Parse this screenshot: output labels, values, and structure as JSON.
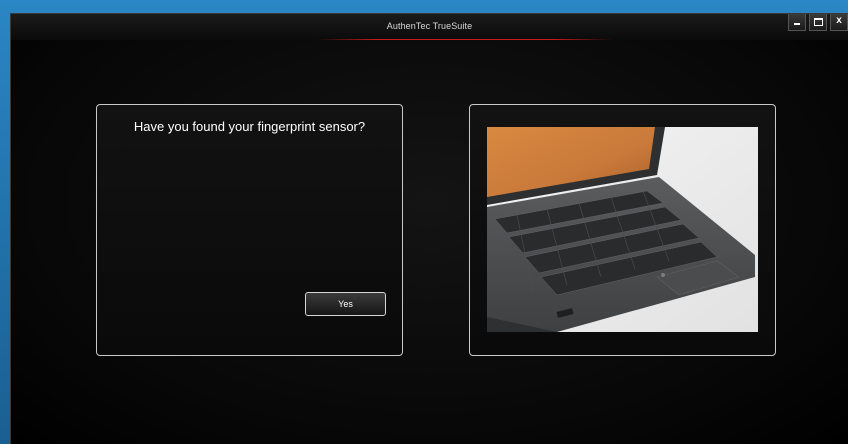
{
  "window": {
    "title": "AuthenTec TrueSuite",
    "controls": {
      "minimize_icon": "minimize-icon",
      "maximize_icon": "maximize-icon",
      "close_label": "x"
    }
  },
  "prompt": {
    "question": "Have you found your fingerprint sensor?",
    "yes_label": "Yes"
  },
  "illustration": {
    "subject": "laptop-fingerprint-sensor-photo"
  },
  "colors": {
    "accent": "#c81a1a",
    "panel_border": "#c9c9c9",
    "background": "#000000"
  }
}
